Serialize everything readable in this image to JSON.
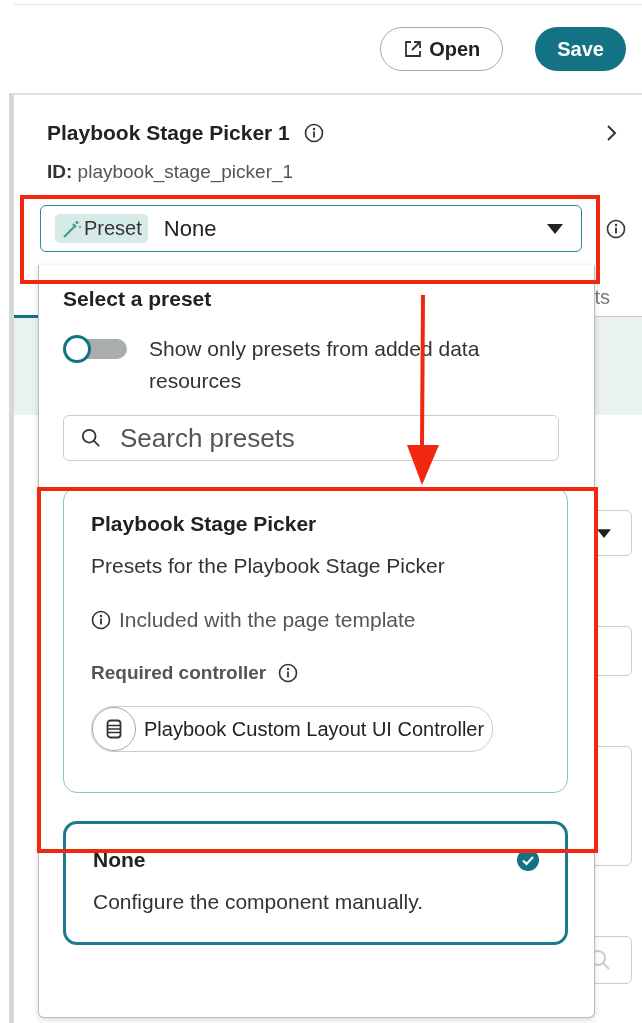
{
  "toolbar": {
    "buttons": [
      {
        "label": "Open",
        "kind": "outline"
      },
      {
        "label": "Save",
        "kind": "primary"
      }
    ]
  },
  "panel": {
    "title": "Playbook Stage Picker 1",
    "id_label": "ID:",
    "id_value": "playbook_stage_picker_1",
    "background_tab": "ts",
    "preset_field": {
      "chip": "Preset",
      "value": "None",
      "expanded": true
    }
  },
  "dropdown": {
    "heading": "Select a preset",
    "toggle": {
      "label": "Show only presets from added data resources",
      "on": false
    },
    "search": {
      "placeholder": "Search presets"
    },
    "presets": [
      {
        "title": "Playbook Stage Picker",
        "description": "Presets for the Playbook Stage Picker",
        "note": "Included with the page template",
        "requirement_label": "Required controller",
        "controller": "Playbook Custom Layout UI Controller",
        "selected": false
      },
      {
        "title": "None",
        "description": "Configure the component manually.",
        "selected": true
      }
    ]
  }
}
